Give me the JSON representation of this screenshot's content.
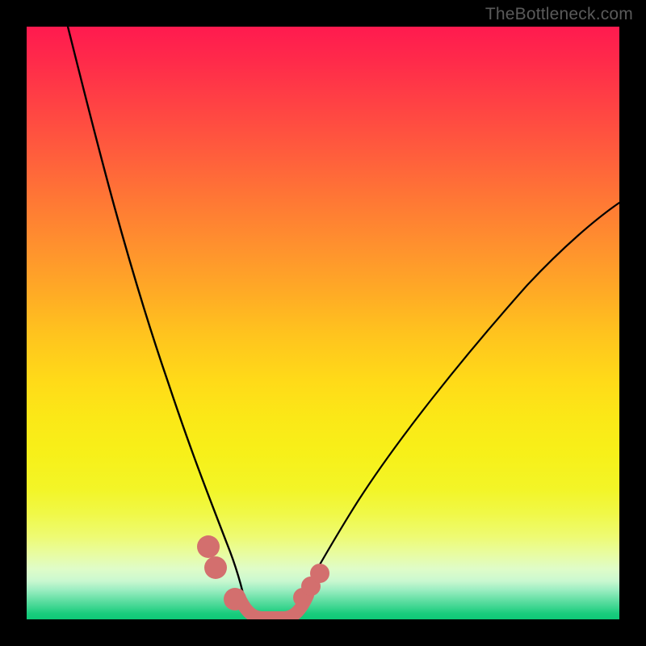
{
  "watermark": "TheBottleneck.com",
  "chart_data": {
    "type": "line",
    "title": "",
    "xlabel": "",
    "ylabel": "",
    "xlim": [
      0,
      100
    ],
    "ylim": [
      0,
      100
    ],
    "grid": false,
    "legend": false,
    "background_gradient": {
      "stops": [
        {
          "pos": 0,
          "color": "#ff1a4f"
        },
        {
          "pos": 50,
          "color": "#ffc81e"
        },
        {
          "pos": 80,
          "color": "#f3f527"
        },
        {
          "pos": 95,
          "color": "#9deec2"
        },
        {
          "pos": 100,
          "color": "#0ec877"
        }
      ]
    },
    "series": [
      {
        "name": "left-curve",
        "color": "#000000",
        "x": [
          7,
          10,
          14,
          18,
          22,
          26,
          29,
          31,
          33,
          35,
          36.5
        ],
        "values": [
          100,
          84,
          67,
          52,
          38,
          25,
          15,
          9,
          5,
          3,
          2
        ]
      },
      {
        "name": "right-curve",
        "color": "#000000",
        "x": [
          45,
          48,
          52,
          58,
          66,
          76,
          88,
          100
        ],
        "values": [
          2,
          4,
          8,
          15,
          25,
          38,
          53,
          68
        ]
      },
      {
        "name": "valley-floor",
        "color": "#d36f6e",
        "x": [
          36,
          38,
          40,
          42,
          44,
          46
        ],
        "values": [
          2,
          0.5,
          0,
          0,
          0.5,
          2
        ]
      }
    ],
    "markers": [
      {
        "series": "valley-left",
        "x": 30.5,
        "y": 12,
        "color": "#d36f6e",
        "r": 2.0
      },
      {
        "series": "valley-left",
        "x": 31.8,
        "y": 8.5,
        "color": "#d36f6e",
        "r": 2.0
      },
      {
        "series": "valley-left",
        "x": 35,
        "y": 3.2,
        "color": "#d36f6e",
        "r": 2.0
      },
      {
        "series": "valley-right",
        "x": 46.5,
        "y": 3.5,
        "color": "#d36f6e",
        "r": 1.7
      },
      {
        "series": "valley-right",
        "x": 48,
        "y": 5.4,
        "color": "#d36f6e",
        "r": 1.7
      },
      {
        "series": "valley-right",
        "x": 49.5,
        "y": 7.7,
        "color": "#d36f6e",
        "r": 1.7
      }
    ]
  }
}
